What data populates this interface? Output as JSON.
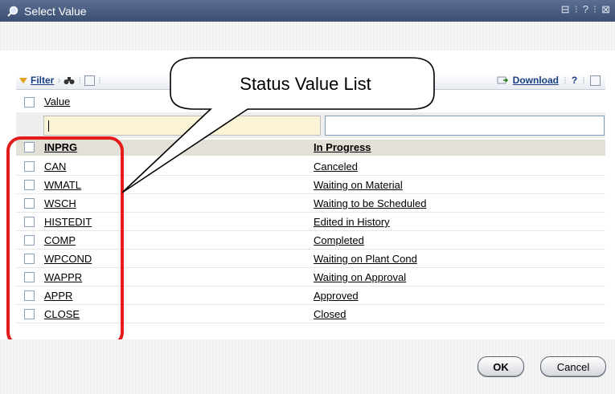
{
  "window": {
    "title": "Select Value",
    "controls": [
      "⊟",
      "?",
      "⊠"
    ]
  },
  "toolbar": {
    "filter_label": "Filter",
    "download_label": "Download",
    "help_label": "?"
  },
  "table": {
    "column_header": "Value",
    "filter_value": "",
    "rows": [
      {
        "code": "INPRG",
        "description": "In Progress"
      },
      {
        "code": "CAN",
        "description": "Canceled"
      },
      {
        "code": "WMATL",
        "description": "Waiting on Material"
      },
      {
        "code": "WSCH",
        "description": "Waiting to be Scheduled"
      },
      {
        "code": "HISTEDIT",
        "description": "Edited in History"
      },
      {
        "code": "COMP",
        "description": "Completed"
      },
      {
        "code": "WPCOND",
        "description": "Waiting on Plant Cond"
      },
      {
        "code": "WAPPR",
        "description": "Waiting on Approval"
      },
      {
        "code": "APPR",
        "description": "Approved"
      },
      {
        "code": "CLOSE",
        "description": "Closed"
      }
    ]
  },
  "annotation": {
    "callout_text": "Status Value List",
    "highlight_color": "#e31b1b"
  },
  "buttons": {
    "ok": "OK",
    "cancel": "Cancel"
  }
}
